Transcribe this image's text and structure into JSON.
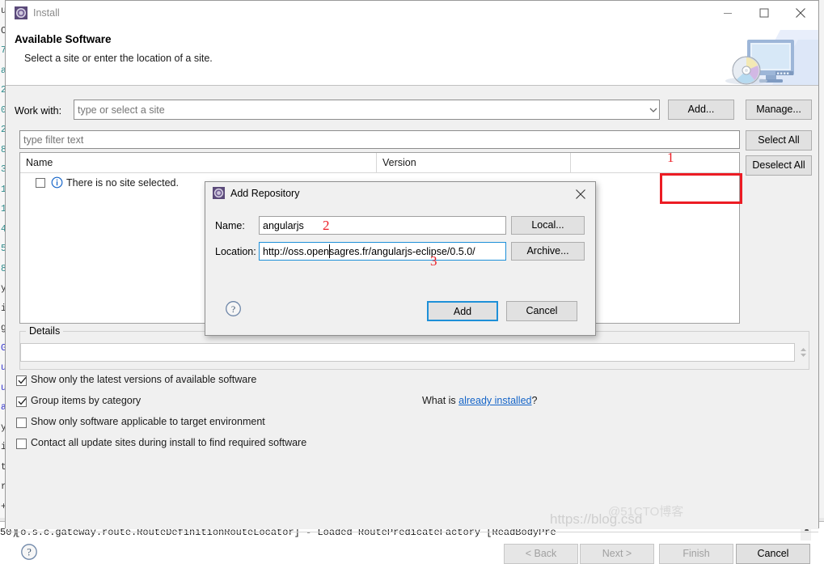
{
  "background": {
    "gutter_lines": [
      "u",
      "C",
      "7",
      "a",
      "2",
      "0",
      "2",
      "8",
      "3",
      "1",
      "1",
      "4",
      "5",
      "8",
      "y",
      "i",
      "g",
      "G",
      "u",
      "u",
      "a",
      "y",
      "i",
      "t",
      "r",
      "+"
    ],
    "console_prefix": "50)",
    "console_text": "[o.s.c.gateway.route.RouteDefinitionRouteLocator] - Loaded RoutePredicateFactory [ReadBodyPre",
    "console_scroll_arrow": "▲"
  },
  "window": {
    "title": "Install",
    "title_icon": "eclipse-install-icon",
    "minimize_icon": "minimize-icon",
    "maximize_icon": "maximize-icon",
    "close_icon": "close-icon"
  },
  "banner": {
    "title": "Available Software",
    "subtitle": "Select a site or enter the location of a site.",
    "image": "monitor-cd-icon"
  },
  "form": {
    "work_with_label": "Work with:",
    "work_with_value": "",
    "work_with_placeholder": "type or select a site",
    "combo_arrow_icon": "chevron-down-icon",
    "add_button": "Add...",
    "manage_button": "Manage...",
    "filter_value": "",
    "filter_placeholder": "type filter text",
    "select_all_button": "Select All",
    "deselect_all_button": "Deselect All"
  },
  "table": {
    "columns": [
      "Name",
      "Version"
    ],
    "rows": [
      {
        "checked": false,
        "icon": "info-icon",
        "name": "There is no site selected.",
        "version": ""
      }
    ]
  },
  "details": {
    "legend": "Details",
    "value": "",
    "spinner_icon": "spinner-up-down-icon"
  },
  "options": [
    {
      "label": "Show only the latest versions of available software",
      "checked": true,
      "name": "show-latest-versions"
    },
    {
      "label": "Group items by category",
      "checked": true,
      "name": "group-by-category"
    },
    {
      "label": "Show only software applicable to target environment",
      "checked": false,
      "name": "show-applicable-software"
    },
    {
      "label": "Contact all update sites during install to find required software",
      "checked": false,
      "name": "contact-update-sites"
    }
  ],
  "already_installed": {
    "prefix": "What is ",
    "link": "already installed",
    "suffix": "?"
  },
  "footer": {
    "help_icon": "help-icon",
    "back_button": "< Back",
    "next_button": "Next >",
    "finish_button": "Finish",
    "cancel_button": "Cancel"
  },
  "modal": {
    "title": "Add Repository",
    "title_icon": "eclipse-install-icon",
    "close_icon": "close-icon",
    "name_label": "Name:",
    "name_value": "angularjs",
    "location_label": "Location:",
    "location_value": "http://oss.opensagres.fr/angularjs-eclipse/0.5.0/",
    "local_button": "Local...",
    "archive_button": "Archive...",
    "help_icon": "help-icon",
    "add_button": "Add",
    "cancel_button": "Cancel"
  },
  "annotations": {
    "step1": "1",
    "step2": "2",
    "step3": "3",
    "accent_color": "#ec1c24"
  },
  "watermark": {
    "text": "https://blog.csd",
    "text2": "@51CTO博客"
  }
}
